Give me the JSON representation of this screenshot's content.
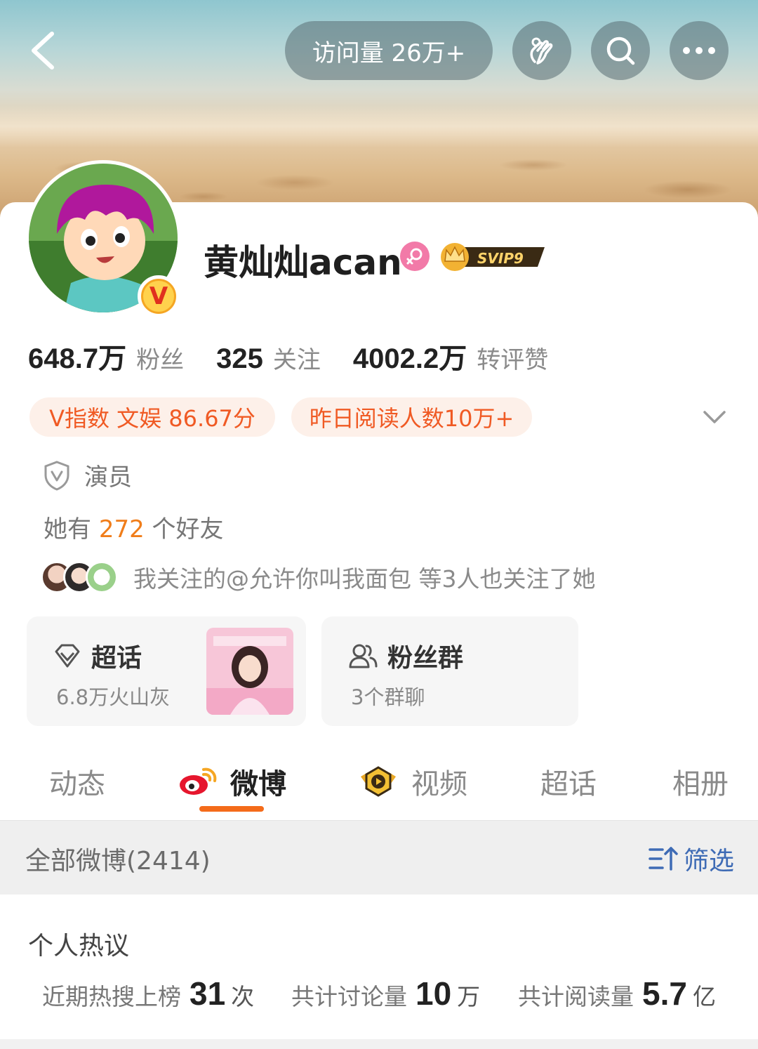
{
  "header": {
    "visits": "访问量 26万+"
  },
  "profile": {
    "nickname": "黄灿灿acan",
    "svip_label": "SVIP9",
    "verified_mark": "V"
  },
  "stats": [
    {
      "value": "648.7万",
      "label": "粉丝"
    },
    {
      "value": "325",
      "label": "关注"
    },
    {
      "value": "4002.2万",
      "label": "转评赞"
    }
  ],
  "chips": {
    "v_index": "V指数 文娱 86.67分",
    "read_count": "昨日阅读人数10万+"
  },
  "role": "演员",
  "friends": {
    "prefix": "她有",
    "count": "272",
    "suffix": "个好友"
  },
  "mutual_follow": "我关注的@允许你叫我面包 等3人也关注了她",
  "tiles": {
    "topic": {
      "title": "超话",
      "subtitle": "6.8万火山灰"
    },
    "group": {
      "title": "粉丝群",
      "subtitle": "3个群聊"
    }
  },
  "tabs": [
    {
      "label": "动态"
    },
    {
      "label": "微博",
      "active": true
    },
    {
      "label": "视频"
    },
    {
      "label": "超话"
    },
    {
      "label": "相册"
    }
  ],
  "feed_bar": {
    "all_label": "全部微博(2414)",
    "filter_label": "筛选"
  },
  "hot_discussion": {
    "title": "个人热议",
    "metrics": [
      {
        "label": "近期热搜上榜",
        "value": "31",
        "unit": "次"
      },
      {
        "label": "共计讨论量",
        "value": "10",
        "unit": "万"
      },
      {
        "label": "共计阅读量",
        "value": "5.7",
        "unit": "亿"
      }
    ]
  },
  "colors": {
    "accent_orange": "#f46b1a",
    "chip_bg": "#fdf0e9",
    "chip_text": "#f05a24",
    "friend_count": "#f07d1a",
    "filter_blue": "#3e6bb5"
  },
  "icons": [
    "back-arrow-icon",
    "hand-heart-icon",
    "search-icon",
    "more-icon",
    "female-icon",
    "svip-crown-icon",
    "chevron-down-icon",
    "shield-v-icon",
    "diamond-icon",
    "group-icon",
    "weibo-logo-icon",
    "video-icon",
    "filter-icon"
  ]
}
